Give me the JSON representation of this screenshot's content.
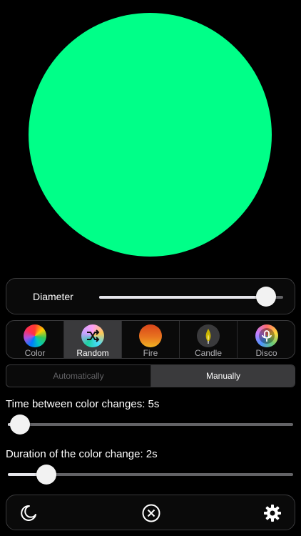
{
  "preview": {
    "color": "#00ff88"
  },
  "diameter": {
    "label": "Diameter",
    "value": 0.92
  },
  "modes": [
    {
      "label": "Color",
      "icon": "color-wheel-icon",
      "selected": false
    },
    {
      "label": "Random",
      "icon": "shuffle-icon",
      "selected": true
    },
    {
      "label": "Fire",
      "icon": "fire-icon",
      "selected": false
    },
    {
      "label": "Candle",
      "icon": "candle-icon",
      "selected": false
    },
    {
      "label": "Disco",
      "icon": "disco-icon",
      "selected": false
    }
  ],
  "change_mode": {
    "automatic_label": "Automatically",
    "manual_label": "Manually",
    "selected": "Manually"
  },
  "time_between": {
    "label": "Time between color changes: 5s",
    "value": 0.04
  },
  "duration": {
    "label": "Duration of the color change: 2s",
    "value": 0.14
  },
  "bottom_bar": {
    "left_icon": "moon-icon",
    "center_icon": "close-circle-icon",
    "right_icon": "gear-icon"
  }
}
